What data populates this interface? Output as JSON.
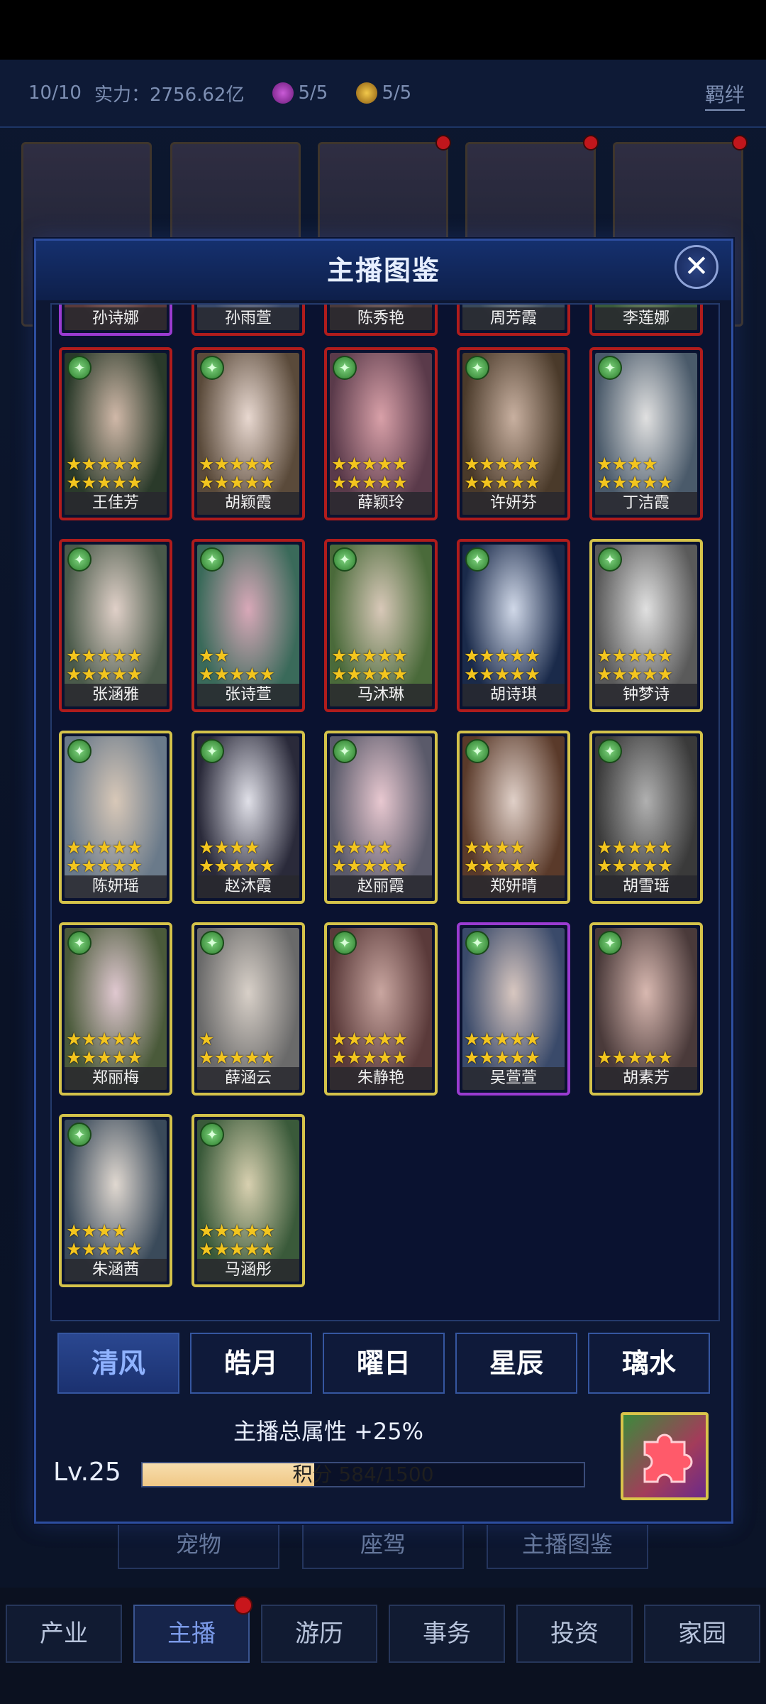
{
  "stats": {
    "count": "10/10",
    "power": "实力：2756.62亿",
    "gem1": "5/5",
    "gem2": "5/5",
    "bond_label": "羁绊"
  },
  "modal": {
    "title": "主播图鉴",
    "close": "✕"
  },
  "cards": [
    {
      "name": "孙诗娜",
      "border": "purple",
      "stars1": "★★★★★",
      "stars2": ""
    },
    {
      "name": "孙雨萱",
      "border": "red",
      "stars1": "★★★★★",
      "stars2": ""
    },
    {
      "name": "陈秀艳",
      "border": "red",
      "stars1": "★★★★★",
      "stars2": ""
    },
    {
      "name": "周芳霞",
      "border": "red",
      "stars1": "★★★★★",
      "stars2": ""
    },
    {
      "name": "李莲娜",
      "border": "red",
      "stars1": "★★★★★",
      "stars2": ""
    },
    {
      "name": "王佳芳",
      "border": "red",
      "stars1": "★★★★★",
      "stars2": "★★★★★"
    },
    {
      "name": "胡颖霞",
      "border": "red",
      "stars1": "★★★★★",
      "stars2": "★★★★★"
    },
    {
      "name": "薛颖玲",
      "border": "red",
      "stars1": "★★★★★",
      "stars2": "★★★★★"
    },
    {
      "name": "许妍芬",
      "border": "red",
      "stars1": "★★★★★",
      "stars2": "★★★★★"
    },
    {
      "name": "丁洁霞",
      "border": "red",
      "stars1": "★★★★",
      "stars2": "★★★★★"
    },
    {
      "name": "张涵雅",
      "border": "red",
      "stars1": "★★★★★",
      "stars2": "★★★★★"
    },
    {
      "name": "张诗萱",
      "border": "red",
      "stars1": "★★",
      "stars2": "★★★★★"
    },
    {
      "name": "马沐琳",
      "border": "red",
      "stars1": "★★★★★",
      "stars2": "★★★★★"
    },
    {
      "name": "胡诗琪",
      "border": "red",
      "stars1": "★★★★★",
      "stars2": "★★★★★"
    },
    {
      "name": "钟梦诗",
      "border": "gold",
      "stars1": "★★★★★",
      "stars2": "★★★★★"
    },
    {
      "name": "陈妍瑶",
      "border": "gold",
      "stars1": "★★★★★",
      "stars2": "★★★★★"
    },
    {
      "name": "赵沐霞",
      "border": "gold",
      "stars1": "★★★★",
      "stars2": "★★★★★"
    },
    {
      "name": "赵丽霞",
      "border": "gold",
      "stars1": "★★★★",
      "stars2": "★★★★★"
    },
    {
      "name": "郑妍晴",
      "border": "gold",
      "stars1": "★★★★",
      "stars2": "★★★★★"
    },
    {
      "name": "胡雪瑶",
      "border": "gold",
      "stars1": "★★★★★",
      "stars2": "★★★★★"
    },
    {
      "name": "郑丽梅",
      "border": "gold",
      "stars1": "★★★★★",
      "stars2": "★★★★★"
    },
    {
      "name": "薛涵云",
      "border": "gold",
      "stars1": "★",
      "stars2": "★★★★★"
    },
    {
      "name": "朱静艳",
      "border": "gold",
      "stars1": "★★★★★",
      "stars2": "★★★★★"
    },
    {
      "name": "吴萱萱",
      "border": "purple",
      "stars1": "★★★★★",
      "stars2": "★★★★★"
    },
    {
      "name": "胡素芳",
      "border": "gold",
      "stars1": "",
      "stars2": "★★★★★"
    },
    {
      "name": "朱涵茜",
      "border": "gold",
      "stars1": "★★★★",
      "stars2": "★★★★★"
    },
    {
      "name": "马涵彤",
      "border": "gold",
      "stars1": "★★★★★",
      "stars2": "★★★★★"
    }
  ],
  "tabs": [
    "清风",
    "皓月",
    "曜日",
    "星辰",
    "璃水"
  ],
  "bonus": "主播总属性 +25%",
  "level": "Lv.25",
  "progress": {
    "text": "积分 584/1500",
    "fraction": 0.389
  },
  "under_buttons": [
    "宠物",
    "座驾",
    "主播图鉴"
  ],
  "nav": [
    "产业",
    "主播",
    "游历",
    "事务",
    "投资",
    "家园"
  ],
  "colors": {
    "accent": "#8fb2ff",
    "red_border": "#b01c1c",
    "gold_border": "#d4c24a",
    "purple_border": "#9a3bd1"
  }
}
